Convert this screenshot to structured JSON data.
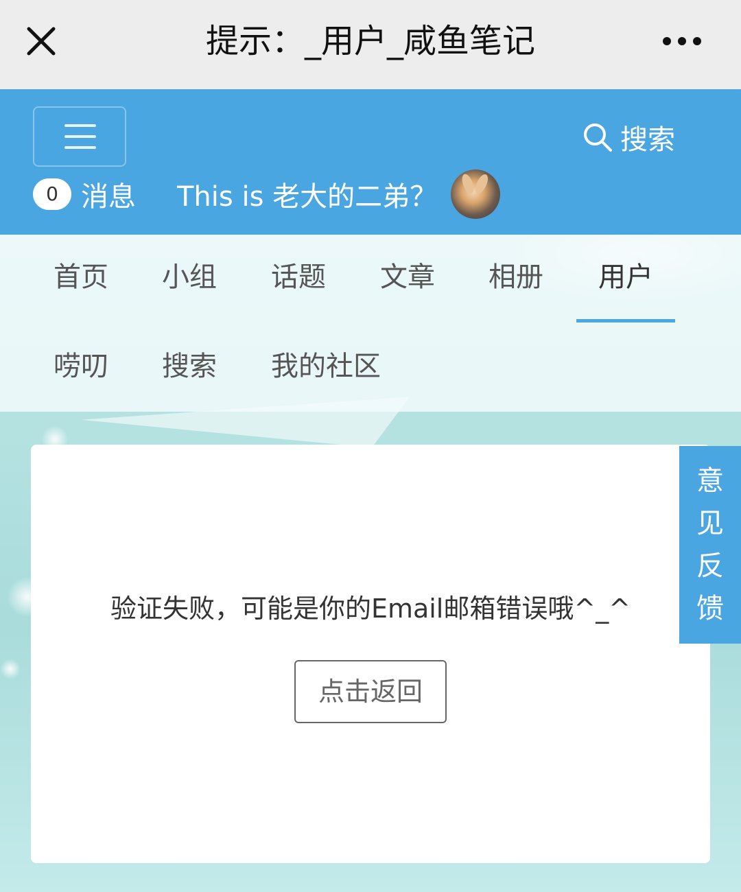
{
  "titlebar": {
    "title": "提示：_用户_咸鱼笔记",
    "close_icon": "close-icon",
    "more_icon": "more-horizontal-icon"
  },
  "header": {
    "menu_icon": "hamburger-menu-icon",
    "search_label": "搜索",
    "search_icon": "search-icon",
    "message_count": "0",
    "message_label": "消息",
    "username": "This is 老大的二弟？",
    "accent_color": "#4aa6e0"
  },
  "nav": {
    "items": [
      {
        "label": "首页"
      },
      {
        "label": "小组"
      },
      {
        "label": "话题"
      },
      {
        "label": "文章"
      },
      {
        "label": "相册"
      },
      {
        "label": "用户"
      },
      {
        "label": "唠叨"
      },
      {
        "label": "搜索"
      },
      {
        "label": "我的社区"
      }
    ],
    "active": "用户"
  },
  "main": {
    "message": "验证失败，可能是你的Email邮箱错误哦^_^",
    "back_button": "点击返回"
  },
  "feedback": {
    "chars": [
      "意",
      "见",
      "反",
      "馈"
    ]
  }
}
